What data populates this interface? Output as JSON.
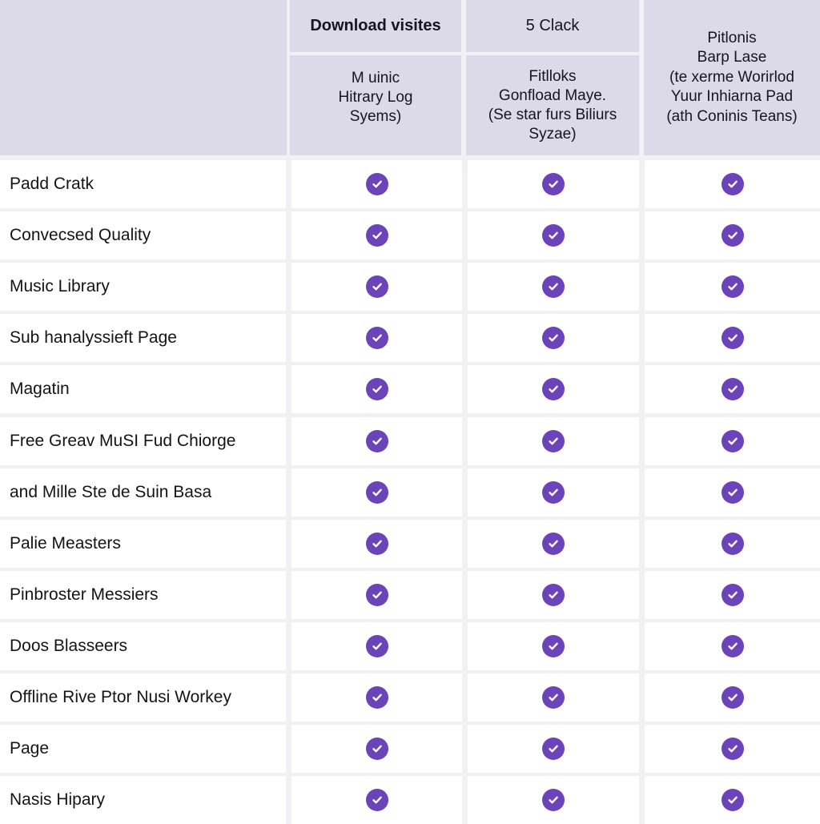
{
  "header": {
    "columns": [
      {
        "title": "Download visites",
        "subtitle": "M uinic\nHitrary Log\nSyems)"
      },
      {
        "title": "5 Clack",
        "subtitle": "Fitlloks\nGonfload Maye.\n(Se star furs Biliurs\nSyzae)"
      },
      {
        "title": "Pitlonis\nBarp Lase\n(te xerme Worirlod\nYuur Inhiarna Pad\n(ath Coninis Teans)"
      }
    ]
  },
  "rows": [
    {
      "label": "Padd Cratk",
      "values": [
        true,
        true,
        true
      ]
    },
    {
      "label": "Convecsed Quality",
      "values": [
        true,
        true,
        true
      ]
    },
    {
      "label": "Music Library",
      "values": [
        true,
        true,
        true
      ]
    },
    {
      "label": "Sub hanalyssieft Page",
      "values": [
        true,
        true,
        true
      ]
    },
    {
      "label": "Magatin",
      "values": [
        true,
        true,
        true
      ]
    },
    {
      "label": "Free Greav MuSI Fud Chiorge",
      "values": [
        true,
        true,
        true
      ]
    },
    {
      "label": "and Mille Ste de Suin Basa",
      "values": [
        true,
        true,
        true
      ]
    },
    {
      "label": "Palie Measters",
      "values": [
        true,
        true,
        true
      ]
    },
    {
      "label": "Pinbroster Messiers",
      "values": [
        true,
        true,
        true
      ]
    },
    {
      "label": "Doos Blasseers",
      "values": [
        true,
        true,
        true
      ]
    },
    {
      "label": "Offline Rive Ptor Nusi Workey",
      "values": [
        true,
        true,
        true
      ]
    },
    {
      "label": "Page",
      "values": [
        true,
        true,
        true
      ]
    },
    {
      "label": "Nasis Hipary",
      "values": [
        true,
        true,
        true
      ]
    }
  ],
  "icons": {
    "check": "check-circle-icon"
  },
  "colors": {
    "accent": "#6a44b8",
    "header_bg": "#dcd9e8"
  }
}
